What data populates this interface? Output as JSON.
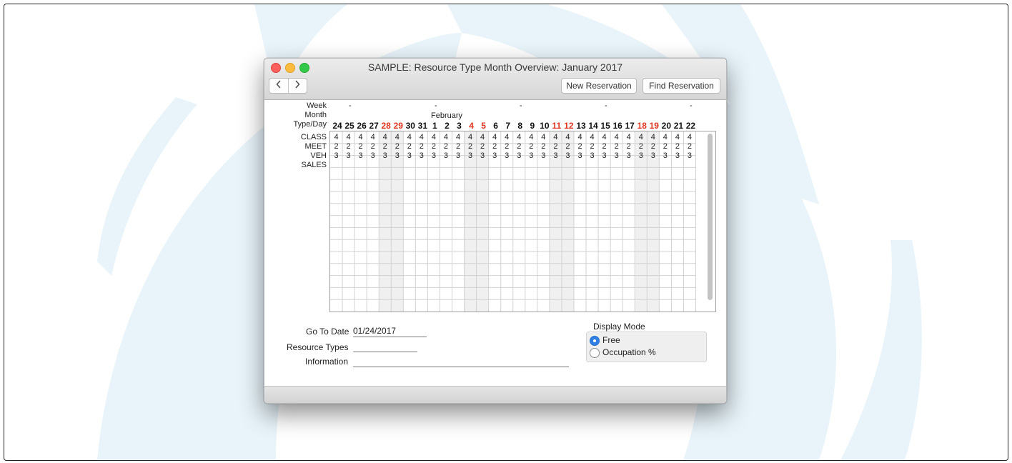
{
  "window": {
    "title": "SAMPLE: Resource Type Month Overview: January 2017"
  },
  "toolbar": {
    "back_icon": "chevron-left-icon",
    "forward_icon": "chevron-right-icon",
    "new_reservation": "New Reservation",
    "find_reservation": "Find Reservation"
  },
  "header": {
    "week_label": "Week",
    "month_label": "Month",
    "typeday_label": "Type/Day",
    "week_marker": "-",
    "month_name": "February"
  },
  "days": [
    {
      "n": "24",
      "we": false
    },
    {
      "n": "25",
      "we": false
    },
    {
      "n": "26",
      "we": false
    },
    {
      "n": "27",
      "we": false
    },
    {
      "n": "28",
      "we": true
    },
    {
      "n": "29",
      "we": true
    },
    {
      "n": "30",
      "we": false
    },
    {
      "n": "31",
      "we": false
    },
    {
      "n": "1",
      "we": false
    },
    {
      "n": "2",
      "we": false
    },
    {
      "n": "3",
      "we": false
    },
    {
      "n": "4",
      "we": true
    },
    {
      "n": "5",
      "we": true
    },
    {
      "n": "6",
      "we": false
    },
    {
      "n": "7",
      "we": false
    },
    {
      "n": "8",
      "we": false
    },
    {
      "n": "9",
      "we": false
    },
    {
      "n": "10",
      "we": false
    },
    {
      "n": "11",
      "we": true
    },
    {
      "n": "12",
      "we": true
    },
    {
      "n": "13",
      "we": false
    },
    {
      "n": "14",
      "we": false
    },
    {
      "n": "15",
      "we": false
    },
    {
      "n": "16",
      "we": false
    },
    {
      "n": "17",
      "we": false
    },
    {
      "n": "18",
      "we": true
    },
    {
      "n": "19",
      "we": true
    },
    {
      "n": "20",
      "we": false
    },
    {
      "n": "21",
      "we": false
    },
    {
      "n": "22",
      "we": false
    }
  ],
  "rows": [
    {
      "label": "CLASS",
      "value": "4"
    },
    {
      "label": "MEET",
      "value": "2"
    },
    {
      "label": "VEH",
      "value": "3"
    },
    {
      "label": "SALES",
      "value": ""
    }
  ],
  "form": {
    "go_to_date_label": "Go To Date",
    "go_to_date_value": "01/24/2017",
    "resource_types_label": "Resource Types",
    "resource_types_value": "",
    "information_label": "Information",
    "information_value": ""
  },
  "display_mode": {
    "title": "Display Mode",
    "options": [
      {
        "label": "Free",
        "selected": true
      },
      {
        "label": "Occupation %",
        "selected": false
      }
    ]
  },
  "colors": {
    "weekend": "#e0341f",
    "weekend_column": "#f0f0f0",
    "accent": "#2f7fe6"
  }
}
